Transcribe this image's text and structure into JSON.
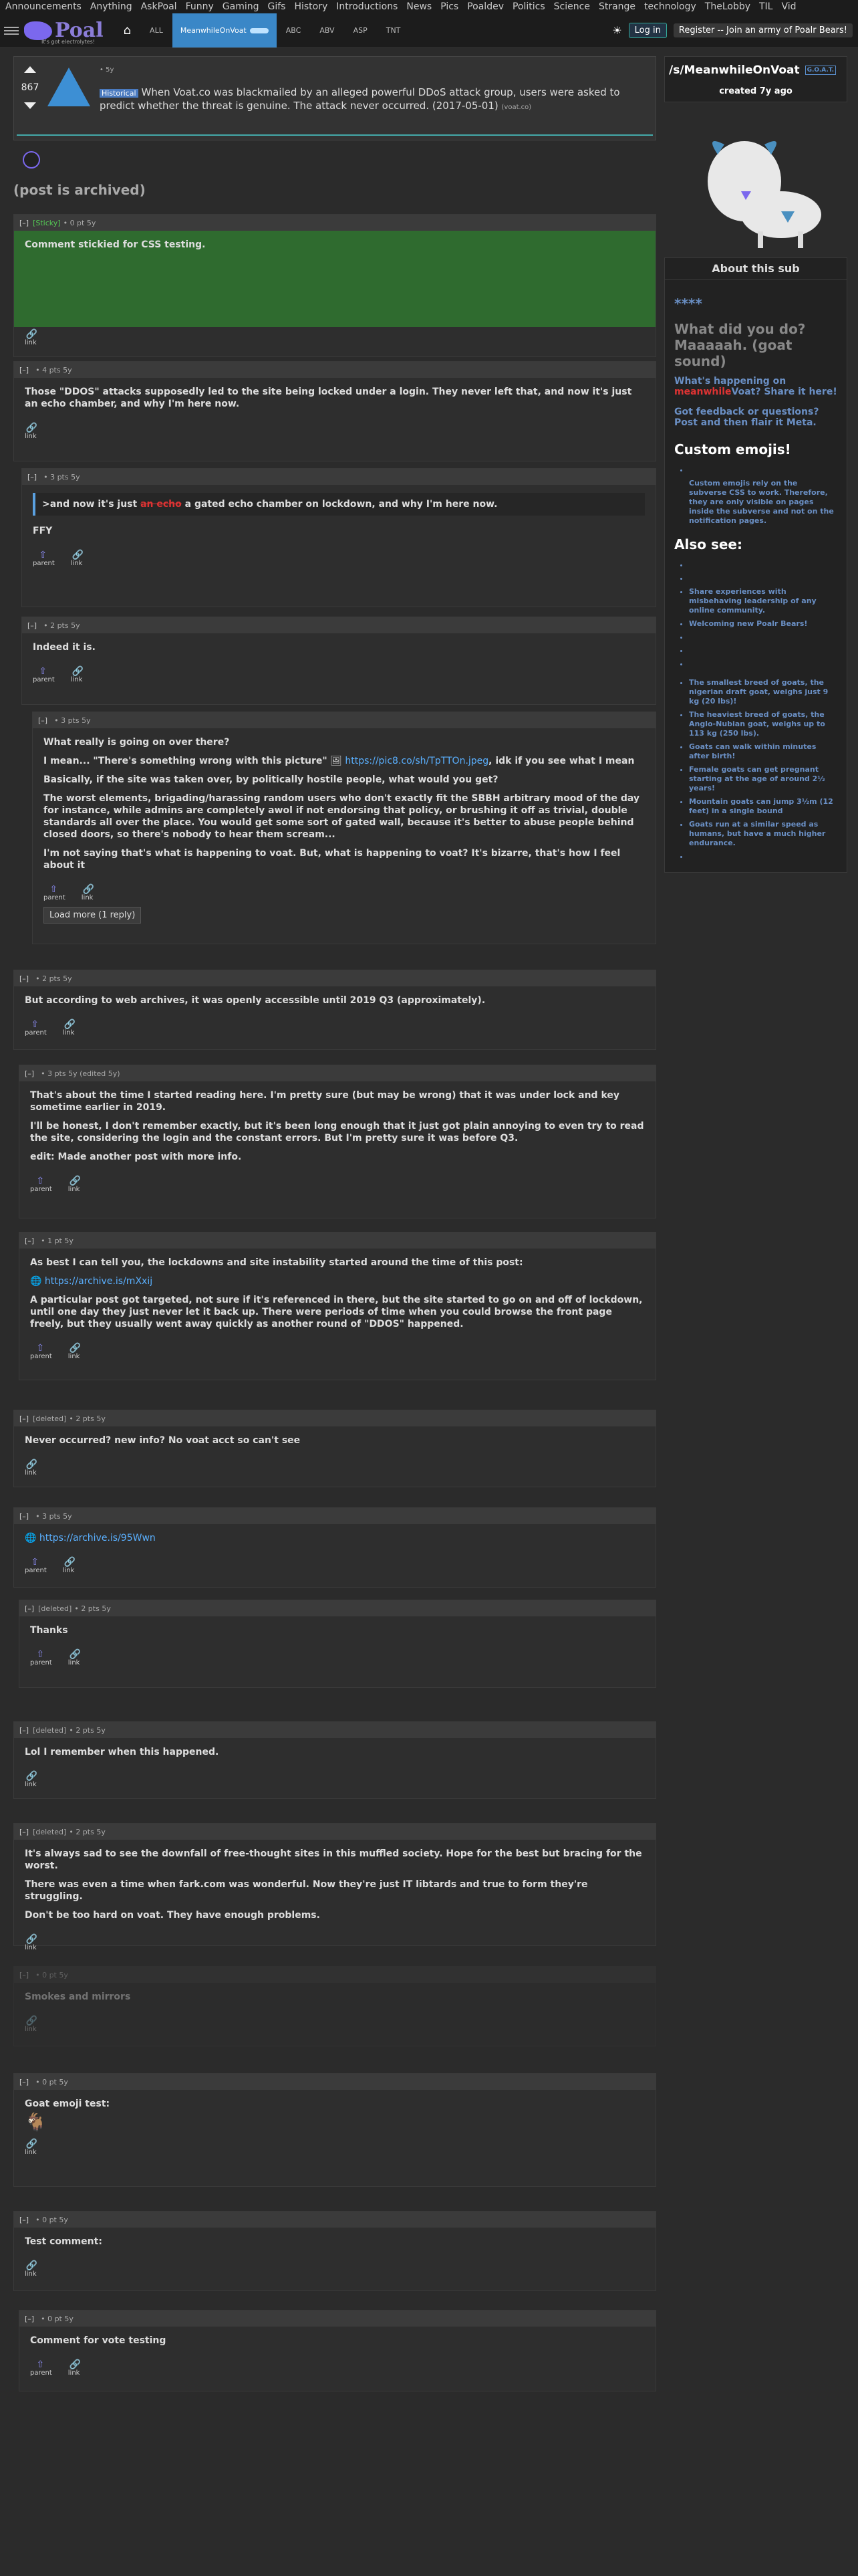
{
  "topnav": [
    "Announcements",
    "Anything",
    "AskPoal",
    "Funny",
    "Gaming",
    "Gifs",
    "History",
    "Introductions",
    "News",
    "Pics",
    "Poaldev",
    "Politics",
    "Science",
    "Strange",
    "technology",
    "TheLobby",
    "TIL",
    "Vid"
  ],
  "header": {
    "logo": "Poal",
    "tagline": "It's got electrolytes!",
    "home": "⌂",
    "nav": [
      "ALL",
      "MeanwhileOnVoat",
      "ABC",
      "ABV",
      "ASP",
      "TNT"
    ],
    "login": "Log in",
    "register": "Register -- Join an army of Poalr Bears!"
  },
  "post": {
    "score": "867",
    "meta": "• 5y",
    "flair": "Historical",
    "title": "When Voat.co was blackmailed by an alleged powerful DDoS attack group, users were asked to predict whether the threat is genuine. The attack never occurred. (2017-05-01)",
    "domain": "(voat.co)",
    "archived": "(post is archived)"
  },
  "comments": [
    {
      "toggle": "[–]",
      "author": "[Sticky]",
      "meta": "• 0 pt 5y",
      "body": [
        "Comment stickied for CSS testing."
      ],
      "actions": [
        "link"
      ]
    },
    {
      "toggle": "[–]",
      "author": "",
      "meta": "• 4 pts 5y",
      "body": [
        "Those \"DDOS\" attacks supposedly led to the site being locked under a login. They never left that, and now it's just an echo chamber, and why I'm here now."
      ],
      "actions": [
        "link"
      ]
    },
    {
      "toggle": "[–]",
      "author": "",
      "meta": "• 3 pts 5y",
      "quote": [
        ">and now it's just ",
        "an echo",
        " a gated echo chamber on lockdown, and why I'm here now."
      ],
      "body": [
        "FFY"
      ],
      "actions": [
        "parent",
        "link"
      ]
    },
    {
      "toggle": "[–]",
      "author": "",
      "meta": "• 2 pts 5y",
      "body": [
        "Indeed it is."
      ],
      "actions": [
        "parent",
        "link"
      ]
    },
    {
      "toggle": "[–]",
      "author": "",
      "meta": "• 3 pts 5y",
      "body": [
        "What really is going on over there?",
        "I mean... \"There's something wrong with this picture\"",
        "https://pic8.co/sh/TpTTOn.jpeg",
        ", idk if you see what I mean",
        "Basically, if the site was taken over, by politically hostile people, what would you get?",
        "The worst elements, brigading/harassing random users who don't exactly fit the SBBH arbitrary mood of the day for instance, while admins are completely awol if not endorsing that policy, or brushing it off as trivial, double standards all over the place. You would get some sort of gated wall, because it's better to abuse people behind closed doors, so there's nobody to hear them scream...",
        "I'm not saying that's what is happening to voat. But, what is happening to voat? It's bizarre, that's how I feel about it"
      ],
      "actions": [
        "parent",
        "link"
      ],
      "load_more": "Load more (1 reply)"
    },
    {
      "toggle": "[–]",
      "author": "",
      "meta": "• 2 pts 5y",
      "body": [
        "But according to web archives, it was openly accessible until 2019 Q3 (approximately)."
      ],
      "actions": [
        "parent",
        "link"
      ]
    },
    {
      "toggle": "[–]",
      "author": "",
      "meta": "• 3 pts 5y (edited 5y)",
      "body": [
        "That's about the time I started reading here. I'm pretty sure (but may be wrong) that it was under lock and key sometime earlier in 2019.",
        "I'll be honest, I don't remember exactly, but it's been long enough that it just got plain annoying to even try to read the site, considering the login and the constant errors. But I'm pretty sure it was before Q3.",
        "edit: Made another post with more info."
      ],
      "actions": [
        "parent",
        "link"
      ]
    },
    {
      "toggle": "[–]",
      "author": "",
      "meta": "• 1 pt 5y",
      "body": [
        "As best I can tell you, the lockdowns and site instability started around the time of this post:",
        "https://archive.is/mXxij",
        "A particular post got targeted, not sure if it's referenced in there, but the site started to go on and off of lockdown, until one day they just never let it back up. There were periods of time when you could browse the front page freely, but they usually went away quickly as another round of \"DDOS\" happened."
      ],
      "actions": [
        "parent",
        "link"
      ]
    },
    {
      "toggle": "[–]",
      "author": "[deleted]",
      "meta": "• 2 pts 5y",
      "body": [
        "Never occurred? new info? No voat acct so can't see"
      ],
      "actions": [
        "link"
      ]
    },
    {
      "toggle": "[–]",
      "author": "",
      "meta": "• 3 pts 5y",
      "body": [
        "https://archive.is/95Wwn"
      ],
      "actions": [
        "parent",
        "link"
      ]
    },
    {
      "toggle": "[–]",
      "author": "[deleted]",
      "meta": "• 2 pts 5y",
      "body": [
        "Thanks"
      ],
      "actions": [
        "parent",
        "link"
      ]
    },
    {
      "toggle": "[–]",
      "author": "[deleted]",
      "meta": "• 2 pts 5y",
      "body": [
        "Lol I remember when this happened."
      ],
      "actions": [
        "link"
      ]
    },
    {
      "toggle": "[–]",
      "author": "[deleted]",
      "meta": "• 2 pts 5y",
      "body": [
        "It's always sad to see the downfall of free-thought sites in this muffled society. Hope for the best but bracing for the worst.",
        "There was even a time when fark.com was wonderful. Now they're just IT libtards and true to form they're struggling.",
        "Don't be too hard on voat. They have enough problems."
      ],
      "actions": [
        "link"
      ]
    },
    {
      "toggle": "[–]",
      "author": "",
      "meta": "• 0 pt 5y",
      "body": [
        "Smokes and mirrors"
      ],
      "actions": [
        "link"
      ]
    },
    {
      "toggle": "[–]",
      "author": "",
      "meta": "• 0 pt 5y",
      "body": [
        "Goat emoji test:"
      ],
      "actions": [
        "link"
      ]
    },
    {
      "toggle": "[–]",
      "author": "",
      "meta": "• 0 pt 5y",
      "body": [
        "Test comment:"
      ],
      "actions": [
        "link"
      ]
    },
    {
      "toggle": "[–]",
      "author": "",
      "meta": "• 0 pt 5y",
      "body": [
        "Comment for vote testing"
      ],
      "actions": [
        "parent",
        "link"
      ]
    }
  ],
  "sidebar": {
    "title": "/s/MeanwhileOnVoat",
    "tag": "G.O.A.T.",
    "created": "created 7y ago",
    "about": "About this sub",
    "stars": "****",
    "q1": "What did you do? Maaaaah. (goat sound)",
    "q2a": "What's happening on ",
    "q2b": "Voat? Share it here!",
    "q3": "Got feedback or questions? Post and then flair it Meta.",
    "emoji_h": "Custom emojis!",
    "emoji_t": "Custom emojis rely on the subverse CSS to work. Therefore, they are only visible on pages inside the subverse and not on the notification pages.",
    "also_h": "Also see:",
    "also": [
      "",
      "",
      "Share experiences with misbehaving leadership of any online community.",
      "Welcoming new Poalr Bears!",
      "",
      "",
      ""
    ],
    "facts": [
      "The smallest breed of goats, the nigerian draft goat, weighs just 9 kg (20 lbs)!",
      "The heaviest breed of goats, the Anglo-Nubian goat, weighs up to 113 kg (250 lbs).",
      "Goats can walk within minutes after birth!",
      "Female goats can get pregnant starting at the age of around 2½ years!",
      "Mountain goats can jump 3½m (12 feet) in a single bound",
      "Goats run at a similar speed as humans, but have a much higher endurance.",
      ""
    ]
  }
}
